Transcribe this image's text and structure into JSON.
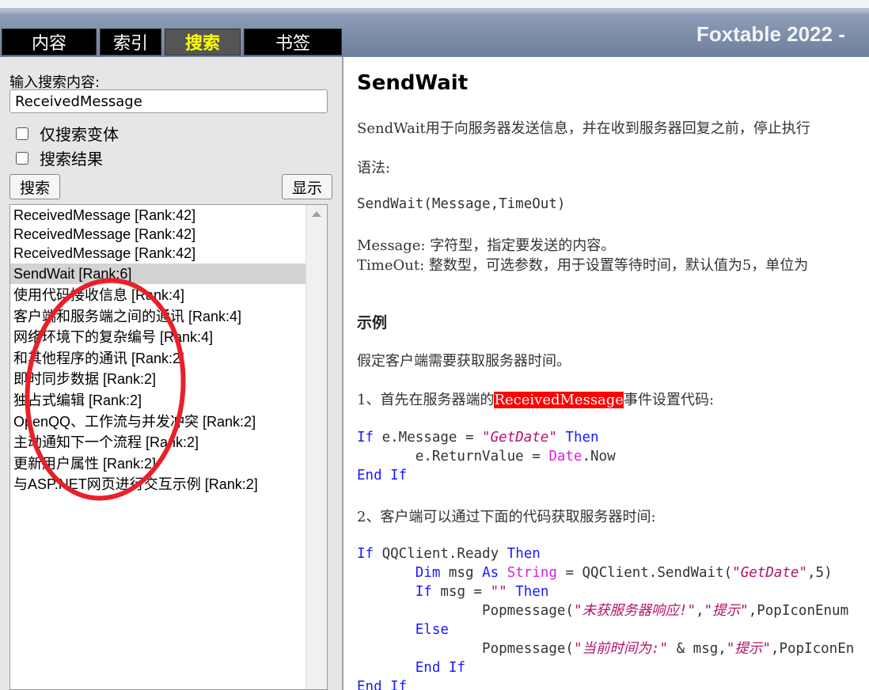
{
  "header": {
    "tabs": [
      {
        "label": "内容",
        "active": false
      },
      {
        "label": "索引",
        "active": false
      },
      {
        "label": "搜索",
        "active": true
      },
      {
        "label": "书签",
        "active": false
      }
    ],
    "brand": "Foxtable 2022 -"
  },
  "search": {
    "label": "输入搜索内容:",
    "value": "ReceivedMessage",
    "option_variants": "仅搜索变体",
    "option_results": "搜索结果",
    "search_button": "搜索",
    "show_button": "显示"
  },
  "results": [
    {
      "text": "ReceivedMessage [Rank:42]",
      "selected": false
    },
    {
      "text": "ReceivedMessage [Rank:42]",
      "selected": false
    },
    {
      "text": "ReceivedMessage [Rank:42]",
      "selected": false
    },
    {
      "text": "SendWait [Rank:6]",
      "selected": true
    },
    {
      "text": "使用代码接收信息 [Rank:4]",
      "selected": false
    },
    {
      "text": "客户端和服务端之间的通讯 [Rank:4]",
      "selected": false
    },
    {
      "text": "网络环境下的复杂编号 [Rank:4]",
      "selected": false
    },
    {
      "text": "和其他程序的通讯 [Rank:2]",
      "selected": false
    },
    {
      "text": "即时同步数据 [Rank:2]",
      "selected": false
    },
    {
      "text": "独占式编辑 [Rank:2]",
      "selected": false
    },
    {
      "text": "OpenQQ、工作流与并发冲突 [Rank:2]",
      "selected": false
    },
    {
      "text": "主动通知下一个流程 [Rank:2]",
      "selected": false
    },
    {
      "text": "更新用户属性 [Rank:2]",
      "selected": false
    },
    {
      "text": "与ASP.NET网页进行交互示例 [Rank:2]",
      "selected": false
    }
  ],
  "colors": {
    "annotation": "#e8202a",
    "highlight": "#ff0000",
    "keyword": "#1a1aff",
    "string": "#b3126a",
    "object": "#e020e0",
    "active_tab_text": "#ffff00"
  },
  "doc": {
    "title": "SendWait",
    "intro": "SendWait用于向服务器发送信息，并在收到服务器回复之前，停止执行",
    "syntax_label": "语法:",
    "syntax": "SendWait(Message,TimeOut)",
    "param1": "Message: 字符型，指定要发送的内容。",
    "param2": "TimeOut: 整数型，可选参数，用于设置等待时间，默认值为5，单位为",
    "example_heading": "示例",
    "example_intro": "假定客户端需要获取服务器时间。",
    "step1_prefix": "1、首先在服务器端的",
    "step1_highlight": "ReceivedMessage",
    "step1_suffix": "事件设置代码:",
    "code1": {
      "l1_kw": "If",
      "l1_a": " e.Message = ",
      "l1_str": "\"GetDate\"",
      "l1_kw2": " Then",
      "l2_a": "       e.ReturnValue = ",
      "l2_obj": "Date",
      "l2_b": ".Now",
      "l3_kw": "End If"
    },
    "step2": "2、客户端可以通过下面的代码获取服务器时间:",
    "code2": {
      "l1_kw": "If",
      "l1_a": " QQClient.Ready ",
      "l1_kw2": "Then",
      "l2_pad": "       ",
      "l2_kw": "Dim",
      "l2_a": " msg ",
      "l2_kw2": "As",
      "l2_sp": " ",
      "l2_obj": "String",
      "l2_b": " = QQClient.SendWait(",
      "l2_str": "\"GetDate\"",
      "l2_c": ",5)",
      "l3_pad": "       ",
      "l3_kw": "If",
      "l3_a": " msg = ",
      "l3_str": "\"\"",
      "l3_sp": " ",
      "l3_kw2": "Then",
      "l4_pad": "               ",
      "l4_a": "Popmessage(",
      "l4_str1": "\"未获服务器响应!\"",
      "l4_b": ",",
      "l4_str2": "\"提示\"",
      "l4_c": ",PopIconEnum",
      "l5_pad": "       ",
      "l5_kw": "Else",
      "l6_pad": "               ",
      "l6_a": "Popmessage(",
      "l6_str1": "\"当前时间为:\"",
      "l6_b": " & msg,",
      "l6_str2": "\"提示\"",
      "l6_c": ",PopIconEn",
      "l7_pad": "       ",
      "l7_kw": "End If",
      "l8_kw": "End If"
    }
  }
}
